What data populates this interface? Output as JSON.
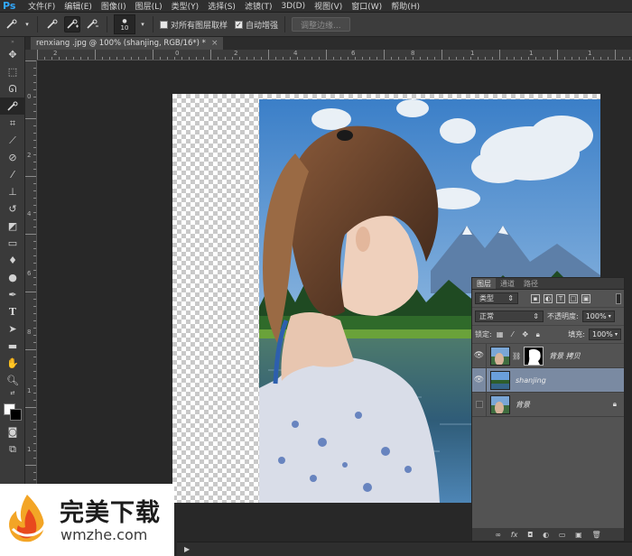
{
  "app": {
    "logo": "Ps"
  },
  "menu": [
    "文件(F)",
    "编辑(E)",
    "图像(I)",
    "图层(L)",
    "类型(Y)",
    "选择(S)",
    "滤镜(T)",
    "3D(D)",
    "视图(V)",
    "窗口(W)",
    "帮助(H)"
  ],
  "options": {
    "brush_size": "10",
    "sample_all_layers_label": "对所有图层取样",
    "sample_all_layers_checked": false,
    "auto_enhance_label": "自动增强",
    "auto_enhance_checked": true,
    "refine_edge_label": "调整边缘..."
  },
  "document": {
    "tab_title": "renxiang .jpg @ 100% (shanjing, RGB/16*) *",
    "tab_close": "×"
  },
  "ruler": {
    "top_labels": [
      "2",
      "0",
      "2",
      "4",
      "6",
      "8",
      "1",
      "1",
      "1"
    ],
    "left_labels": [
      "0",
      "2",
      "4",
      "6",
      "8",
      "1",
      "1",
      "1"
    ]
  },
  "layers_panel": {
    "tabs": [
      "图层",
      "通道",
      "路径"
    ],
    "filter_label": "类型",
    "blend_mode": "正常",
    "opacity_label": "不透明度:",
    "opacity_value": "100%",
    "lock_label": "锁定:",
    "fill_label": "填充:",
    "fill_value": "100%",
    "layers": [
      {
        "name": "背景 拷贝",
        "visible": true,
        "selected": false,
        "has_mask": true,
        "locked": false
      },
      {
        "name": "shanjing",
        "visible": true,
        "selected": true,
        "has_mask": false,
        "locked": false
      },
      {
        "name": "背景",
        "visible": false,
        "selected": false,
        "has_mask": false,
        "locked": true
      }
    ],
    "footer_icons": [
      "link-icon",
      "fx-icon",
      "mask-icon",
      "adjustment-icon",
      "folder-icon",
      "new-layer-icon",
      "trash-icon"
    ],
    "footer_labels": [
      "∞",
      "fx",
      "◘",
      "◐",
      "▭",
      "▣",
      "🗑"
    ]
  },
  "watermark": {
    "title": "完美下载",
    "subtitle": "wmzhe.com"
  },
  "colors": {
    "foreground": "#ffffff",
    "background": "#000000",
    "accent": "#31a8ff",
    "selected_layer": "#7a8aa2"
  }
}
